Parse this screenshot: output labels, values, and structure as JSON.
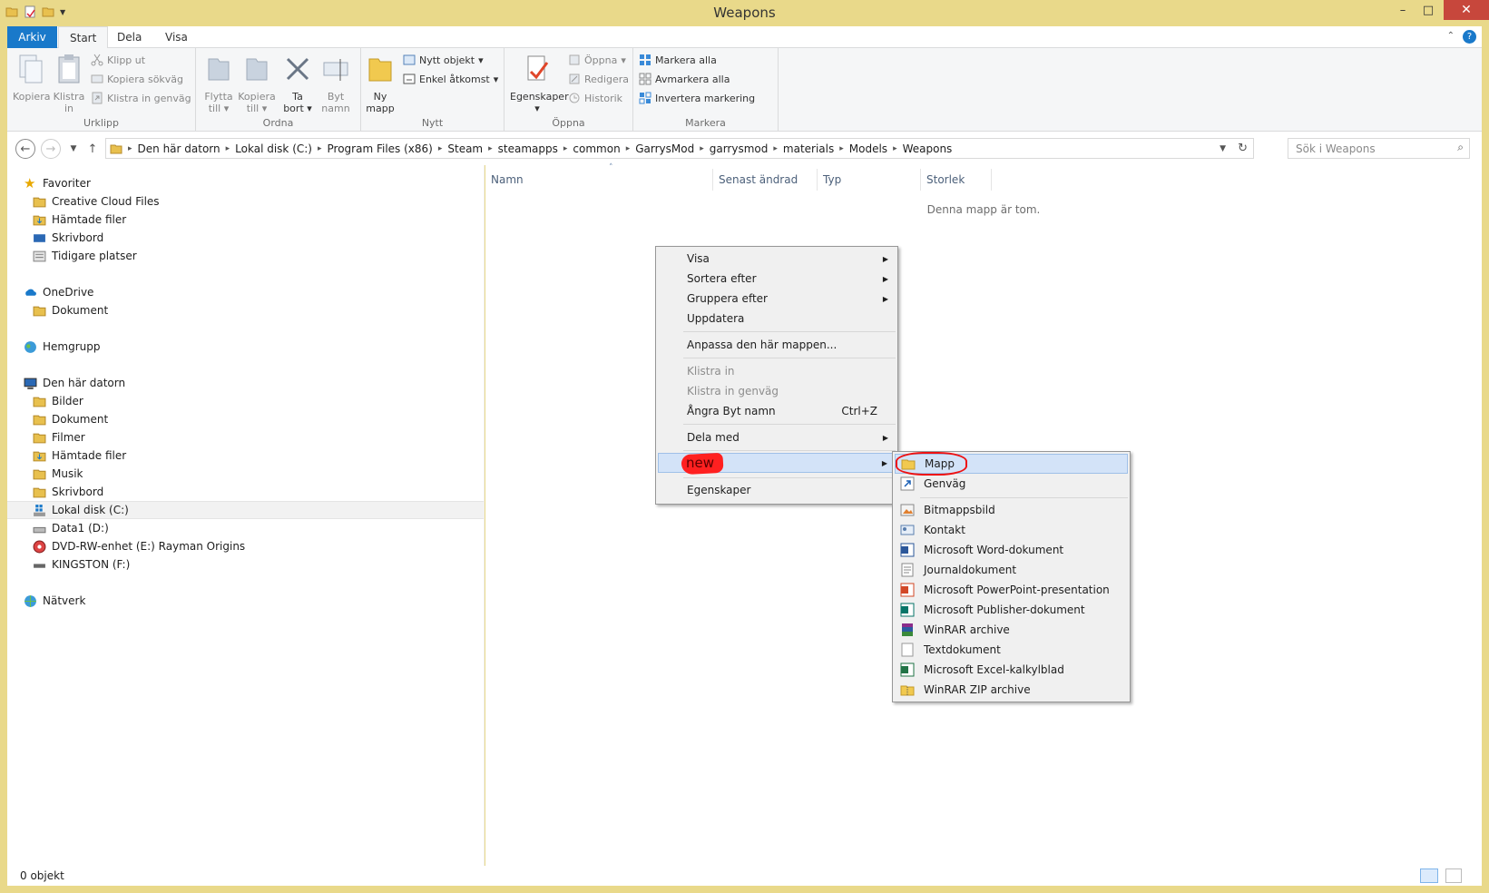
{
  "window": {
    "title": "Weapons"
  },
  "ribbon": {
    "tabs": [
      "Arkiv",
      "Start",
      "Dela",
      "Visa"
    ],
    "clipboard": {
      "copy": "Kopiera",
      "paste_1": "Klistra",
      "paste_2": "in",
      "cut": "Klipp ut",
      "copy_path": "Kopiera sökväg",
      "paste_shortcut": "Klistra in genväg",
      "label": "Urklipp"
    },
    "organize": {
      "move_1": "Flytta",
      "move_2": "till",
      "copy_1": "Kopiera",
      "copy_2": "till",
      "delete_1": "Ta",
      "delete_2": "bort",
      "rename_1": "Byt",
      "rename_2": "namn",
      "label": "Ordna"
    },
    "new": {
      "new_folder_1": "Ny",
      "new_folder_2": "mapp",
      "new_item": "Nytt objekt",
      "easy_access": "Enkel åtkomst",
      "label": "Nytt"
    },
    "open": {
      "properties": "Egenskaper",
      "open": "Öppna",
      "edit": "Redigera",
      "history": "Historik",
      "label": "Öppna"
    },
    "select": {
      "select_all": "Markera alla",
      "select_none": "Avmarkera alla",
      "invert": "Invertera markering",
      "label": "Markera"
    }
  },
  "address": {
    "crumbs": [
      "Den här datorn",
      "Lokal disk (C:)",
      "Program Files (x86)",
      "Steam",
      "steamapps",
      "common",
      "GarrysMod",
      "garrysmod",
      "materials",
      "Models",
      "Weapons"
    ],
    "search_placeholder": "Sök i Weapons"
  },
  "nav": {
    "favorites": "Favoriter",
    "fav_items": [
      "Creative Cloud Files",
      "Hämtade filer",
      "Skrivbord",
      "Tidigare platser"
    ],
    "onedrive": "OneDrive",
    "onedrive_items": [
      "Dokument"
    ],
    "homegroup": "Hemgrupp",
    "thispc": "Den här datorn",
    "pc_items": [
      "Bilder",
      "Dokument",
      "Filmer",
      "Hämtade filer",
      "Musik",
      "Skrivbord",
      "Lokal disk (C:)",
      "Data1 (D:)",
      "DVD-RW-enhet (E:) Rayman Origins",
      "KINGSTON (F:)"
    ],
    "network": "Nätverk"
  },
  "columns": [
    "Namn",
    "Senast ändrad",
    "Typ",
    "Storlek"
  ],
  "empty_text": "Denna mapp är tom.",
  "status": "0 objekt",
  "context_menu": {
    "view": "Visa",
    "sort": "Sortera efter",
    "group": "Gruppera efter",
    "refresh": "Uppdatera",
    "customize": "Anpassa den här mappen...",
    "paste": "Klistra in",
    "paste_shortcut": "Klistra in genväg",
    "undo": "Ångra Byt namn",
    "undo_shortcut": "Ctrl+Z",
    "share": "Dela med",
    "new": "new",
    "properties": "Egenskaper"
  },
  "submenu": {
    "items": [
      "Mapp",
      "Genväg",
      "Bitmappsbild",
      "Kontakt",
      "Microsoft Word-dokument",
      "Journaldokument",
      "Microsoft PowerPoint-presentation",
      "Microsoft Publisher-dokument",
      "WinRAR archive",
      "Textdokument",
      "Microsoft Excel-kalkylblad",
      "WinRAR ZIP archive"
    ]
  },
  "colors": {
    "accent": "#1979ca",
    "titlebar": "#e9d98a",
    "close": "#c7473c",
    "highlight": "#d3e3f8"
  }
}
